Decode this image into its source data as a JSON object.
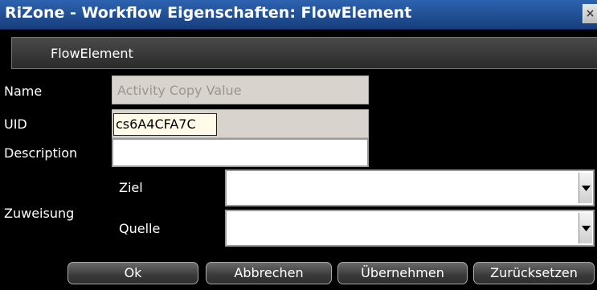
{
  "window": {
    "title": "RiZone - Workflow Eigenschaften: FlowElement",
    "close_glyph": "×"
  },
  "tab": {
    "label": "FlowElement"
  },
  "form": {
    "name_label": "Name",
    "name_value": "Activity Copy Value",
    "uid_label": "UID",
    "uid_value": "cs6A4CFA7C",
    "description_label": "Description",
    "description_value": "",
    "assignment_label": "Zuweisung",
    "target_label": "Ziel",
    "target_value": "",
    "source_label": "Quelle",
    "source_value": ""
  },
  "buttons": {
    "ok": "Ok",
    "cancel": "Abbrechen",
    "apply": "Übernehmen",
    "reset": "Zurücksetzen"
  },
  "colors": {
    "title_bar": "#1f4f96",
    "background": "#000000",
    "readonly_field": "#d8d3cd",
    "uid_highlight": "#fffbe8"
  }
}
